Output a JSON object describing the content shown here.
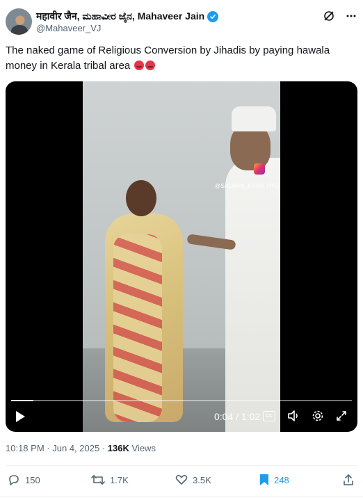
{
  "author": {
    "name": "महावीर जैन, ಮಹಾವೀರ ಜೈನ, Mahaveer Jain",
    "handle": "@Mahaveer_VJ"
  },
  "header_icons": [
    "grok-icon",
    "more-icon"
  ],
  "tweet": {
    "text": "The naked game of Religious Conversion by Jihadis by paying hawala money in Kerala tribal area",
    "emojis": [
      "angry-face",
      "angry-face"
    ]
  },
  "video": {
    "watermark": "@SALMAN_KHAN_HYD",
    "current_time": "0:04",
    "duration": "1:02",
    "progress_fraction": 0.065,
    "controls": [
      "play-icon",
      "cc-icon",
      "volume-icon",
      "settings-icon",
      "fullscreen-icon"
    ]
  },
  "meta": {
    "time": "10:18 PM",
    "separator": "·",
    "date": "Jun 4, 2025",
    "views_count": "136K",
    "views_label": "Views"
  },
  "actions": {
    "replies": "150",
    "reposts": "1.7K",
    "likes": "3.5K",
    "bookmarks": "248"
  },
  "colors": {
    "accent": "#1d9bf0",
    "muted": "#536471",
    "text": "#0f1419"
  }
}
